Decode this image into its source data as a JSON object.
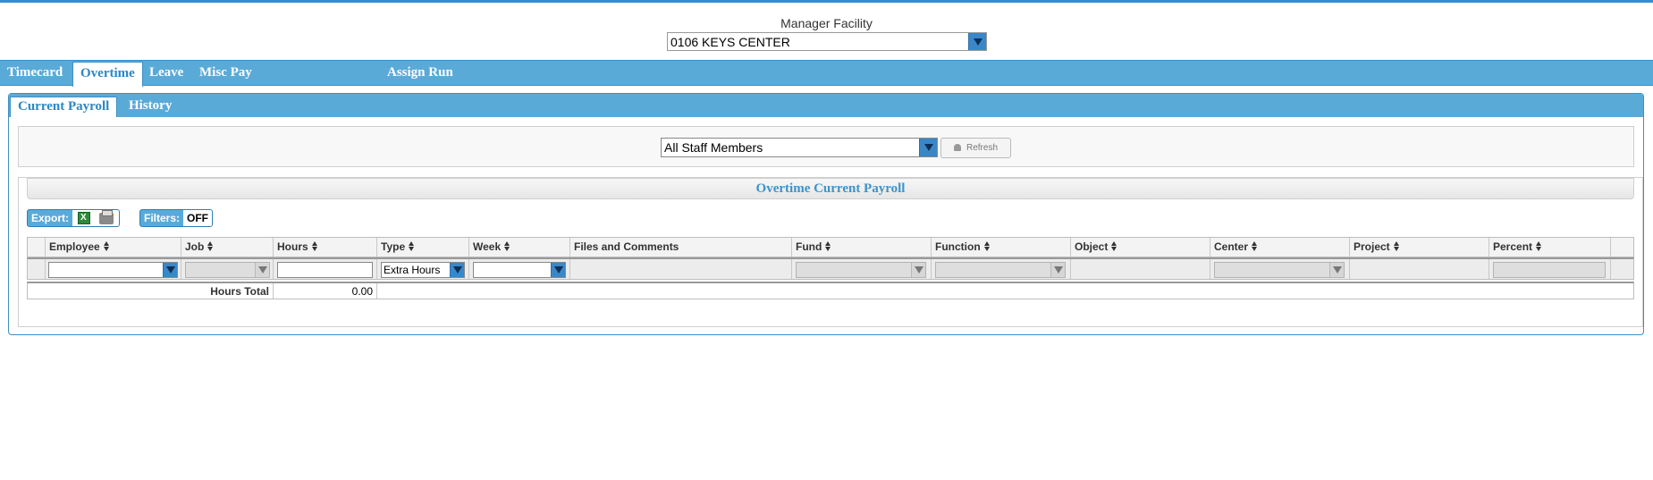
{
  "facility": {
    "label": "Manager Facility",
    "selected": "0106 KEYS CENTER"
  },
  "main_tabs": [
    {
      "label": "Timecard"
    },
    {
      "label": "Overtime"
    },
    {
      "label": "Leave"
    },
    {
      "label": "Misc Pay"
    },
    {
      "label": "Assign Run"
    }
  ],
  "sub_tabs": [
    {
      "label": "Current Payroll"
    },
    {
      "label": "History"
    }
  ],
  "staff_filter": {
    "selected": "All Staff Members",
    "refresh_label": "Refresh"
  },
  "grid": {
    "title": "Overtime Current Payroll",
    "export_label": "Export:",
    "filters_label": "Filters:",
    "filters_state": "OFF",
    "columns": [
      "Employee",
      "Job",
      "Hours",
      "Type",
      "Week",
      "Files and Comments",
      "Fund",
      "Function",
      "Object",
      "Center",
      "Project",
      "Percent"
    ],
    "type_filter_value": "Extra Hours",
    "footer": {
      "label": "Hours Total",
      "value": "0.00"
    }
  },
  "colors": {
    "accent": "#5aaad8",
    "accent_dark": "#3d8fc4",
    "top_line": "#2e8fd6"
  }
}
